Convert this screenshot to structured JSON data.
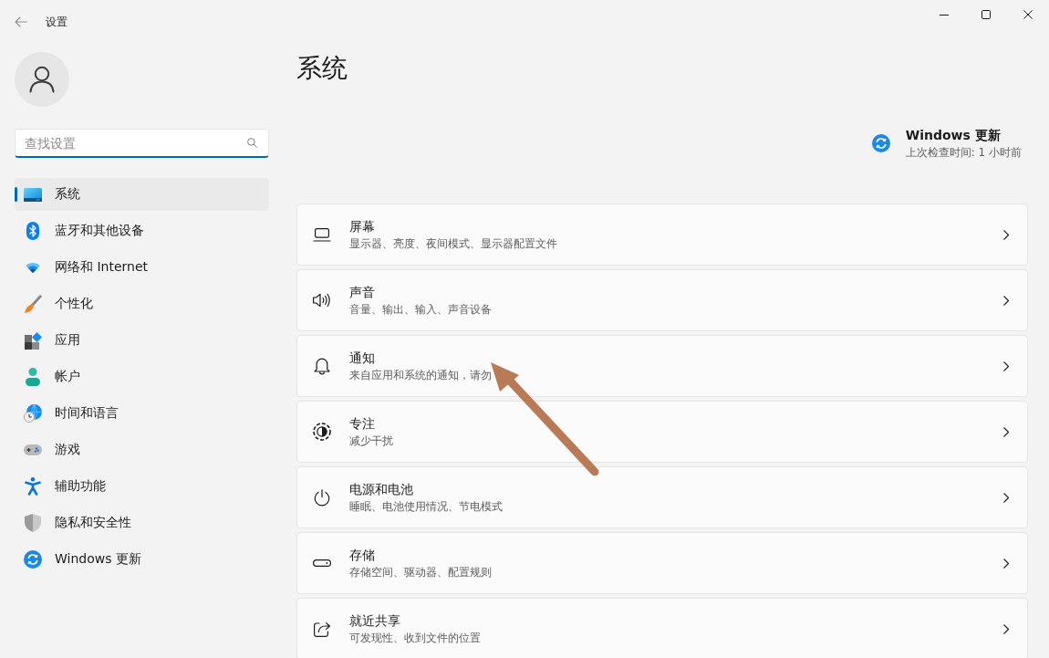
{
  "window": {
    "title": "设置"
  },
  "search": {
    "placeholder": "查找设置"
  },
  "sidebar": {
    "items": [
      {
        "label": "系统",
        "selected": true
      },
      {
        "label": "蓝牙和其他设备",
        "selected": false
      },
      {
        "label": "网络和 Internet",
        "selected": false
      },
      {
        "label": "个性化",
        "selected": false
      },
      {
        "label": "应用",
        "selected": false
      },
      {
        "label": "帐户",
        "selected": false
      },
      {
        "label": "时间和语言",
        "selected": false
      },
      {
        "label": "游戏",
        "selected": false
      },
      {
        "label": "辅助功能",
        "selected": false
      },
      {
        "label": "隐私和安全性",
        "selected": false
      },
      {
        "label": "Windows 更新",
        "selected": false
      }
    ]
  },
  "page": {
    "title": "系统"
  },
  "update_status": {
    "title": "Windows 更新",
    "subtitle": "上次检查时间: 1 小时前"
  },
  "cards": [
    {
      "title": "屏幕",
      "description": "显示器、亮度、夜间模式、显示器配置文件"
    },
    {
      "title": "声音",
      "description": "音量、输出、输入、声音设备"
    },
    {
      "title": "通知",
      "description": "来自应用和系统的通知，请勿"
    },
    {
      "title": "专注",
      "description": "减少干扰"
    },
    {
      "title": "电源和电池",
      "description": "睡眠、电池使用情况、节电模式"
    },
    {
      "title": "存储",
      "description": "存储空间、驱动器、配置规则"
    },
    {
      "title": "就近共享",
      "description": "可发现性、收到文件的位置"
    }
  ]
}
